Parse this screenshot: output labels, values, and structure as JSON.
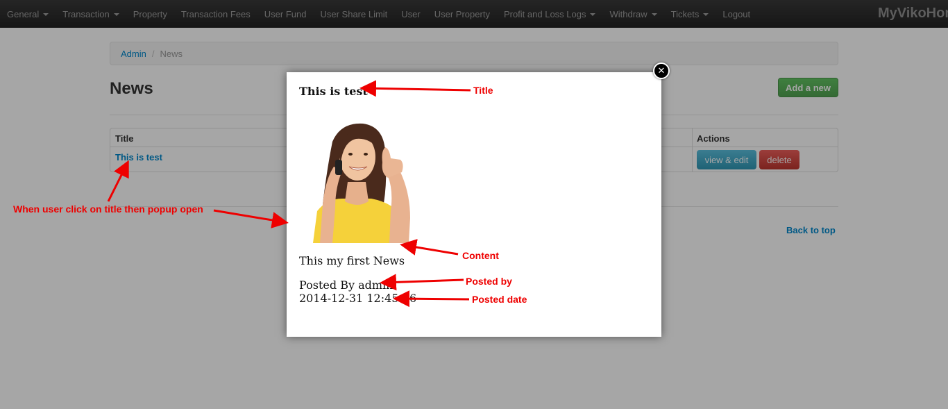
{
  "nav": {
    "items": [
      {
        "label": "General",
        "dropdown": true
      },
      {
        "label": "Transaction",
        "dropdown": true
      },
      {
        "label": "Property",
        "dropdown": false
      },
      {
        "label": "Transaction Fees",
        "dropdown": false
      },
      {
        "label": "User Fund",
        "dropdown": false
      },
      {
        "label": "User Share Limit",
        "dropdown": false
      },
      {
        "label": "User",
        "dropdown": false
      },
      {
        "label": "User Property",
        "dropdown": false
      },
      {
        "label": "Profit and Loss Logs",
        "dropdown": true
      },
      {
        "label": "Withdraw",
        "dropdown": true
      },
      {
        "label": "Tickets",
        "dropdown": true
      },
      {
        "label": "Logout",
        "dropdown": false
      }
    ],
    "brand": "MyVikoHom"
  },
  "breadcrumb": {
    "root": "Admin",
    "separator": "/",
    "current": "News"
  },
  "page": {
    "title": "News",
    "add_button": "Add a new",
    "back_to_top": "Back to top"
  },
  "table": {
    "headers": {
      "title": "Title",
      "actions": "Actions"
    },
    "rows": [
      {
        "title": "This is test",
        "edit": "view & edit",
        "delete": "delete"
      }
    ]
  },
  "modal": {
    "title": "This is test",
    "content": "This my first News",
    "posted_by": "Posted By admin",
    "posted_date": "2014-12-31 12:45:06",
    "close_icon": "close-icon"
  },
  "annotations": {
    "title": "Title",
    "content": "Content",
    "posted_by": "Posted by",
    "posted_date": "Posted date",
    "click_note": "When user click on title then popup open",
    "color": "#ee0000"
  },
  "colors": {
    "link": "#0088cc",
    "success": "#51a351",
    "info": "#2f96b4",
    "danger": "#bd362f"
  }
}
